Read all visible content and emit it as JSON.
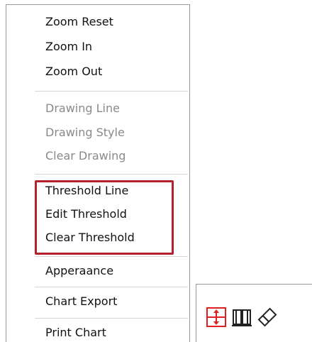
{
  "menu": {
    "items": [
      {
        "label": "Zoom Reset",
        "enabled": true
      },
      {
        "label": "Zoom In",
        "enabled": true
      },
      {
        "label": "Zoom Out",
        "enabled": true
      },
      {
        "label": "Drawing Line",
        "enabled": false
      },
      {
        "label": "Drawing Style",
        "enabled": false
      },
      {
        "label": "Clear Drawing",
        "enabled": false
      },
      {
        "label": "Threshold Line",
        "enabled": true
      },
      {
        "label": "Edit Threshold",
        "enabled": true
      },
      {
        "label": "Clear Threshold",
        "enabled": true
      },
      {
        "label": "Apperaance",
        "enabled": true
      },
      {
        "label": "Chart Export",
        "enabled": true
      },
      {
        "label": "Print Chart",
        "enabled": true
      }
    ],
    "highlight_color": "#b3222b"
  },
  "toolbar": {
    "icons": [
      "threshold-line-icon",
      "book-icon",
      "eraser-icon"
    ],
    "accent_color": "#e02020"
  }
}
